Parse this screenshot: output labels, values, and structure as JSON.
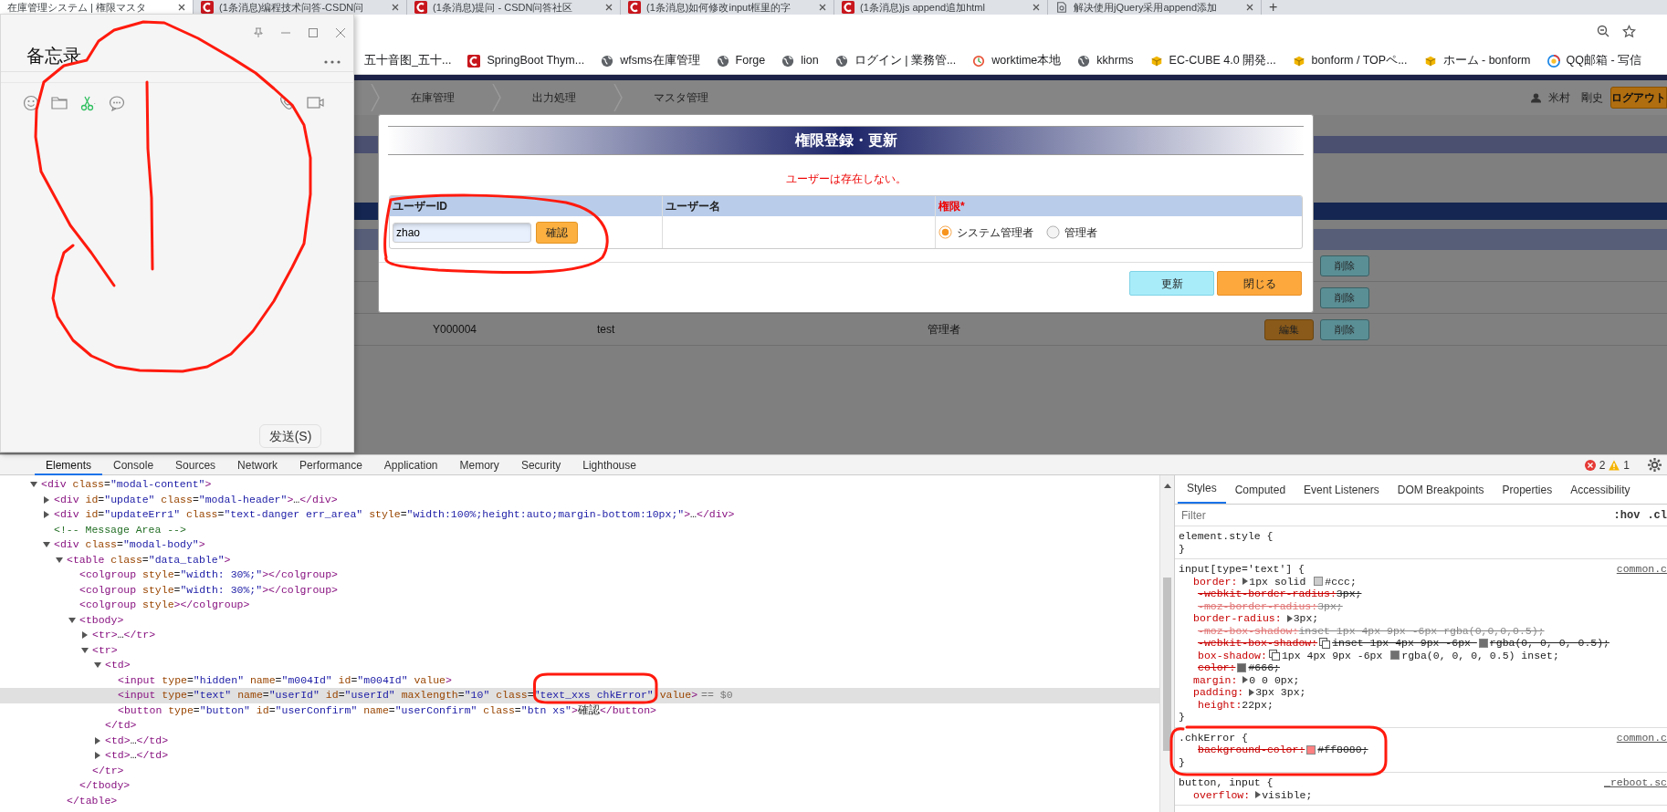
{
  "browser": {
    "tabs": [
      {
        "title": "在庫管理システム | 権限マスタ",
        "selected": true
      },
      {
        "title": "(1条消息)编程技术问答-CSDN问",
        "selected": false,
        "kind": "csdn"
      },
      {
        "title": "(1条消息)提问 - CSDN问答社区",
        "selected": false,
        "kind": "csdn"
      },
      {
        "title": "(1条消息)如何修改input框里的字",
        "selected": false,
        "kind": "csdn"
      },
      {
        "title": "(1条消息)js append追加html",
        "selected": false,
        "kind": "csdn"
      },
      {
        "title": "解决使用jQuery采用append添加",
        "selected": false,
        "kind": "page"
      }
    ],
    "new_tab": "+",
    "bookmarks": [
      {
        "label": "五十音图_五十..."
      },
      {
        "label": "SpringBoot Thym...",
        "kind": "csdn"
      },
      {
        "label": "wfsms在庫管理",
        "kind": "globe"
      },
      {
        "label": "Forge",
        "kind": "globe"
      },
      {
        "label": "lion",
        "kind": "globe"
      },
      {
        "label": "ログイン | 業務管...",
        "kind": "globe"
      },
      {
        "label": "worktime本地",
        "kind": "clock"
      },
      {
        "label": "kkhrms",
        "kind": "globe"
      },
      {
        "label": "EC-CUBE 4.0 開発...",
        "kind": "cube"
      },
      {
        "label": "bonform / TOPペ...",
        "kind": "cube"
      },
      {
        "label": "ホーム - bonform",
        "kind": "cube"
      },
      {
        "label": "QQ邮箱 - 写信",
        "kind": "mail"
      }
    ]
  },
  "app": {
    "nav": [
      "在庫管理",
      "出力処理",
      "マスタ管理"
    ],
    "user_name": "米村　剛史",
    "logout": "ログアウト",
    "rows": [
      {
        "buttons": [
          {
            "label": "削除",
            "kind": "delete"
          }
        ]
      },
      {
        "buttons": [
          {
            "label": "削除",
            "kind": "delete"
          }
        ]
      },
      {
        "id": "Y000004",
        "name": "test",
        "role": "管理者",
        "buttons": [
          {
            "label": "編集",
            "kind": "edit"
          },
          {
            "label": "削除",
            "kind": "delete"
          }
        ]
      }
    ]
  },
  "modal": {
    "title": "権限登録・更新",
    "error": "ユーザーは存在しない。",
    "columns": [
      {
        "label": "ユーザーID",
        "required": false
      },
      {
        "label": "ユーザー名",
        "required": false
      },
      {
        "label": "権限",
        "required": true,
        "mark": "*"
      }
    ],
    "user_id": "zhao",
    "confirm": "確認",
    "roles": [
      {
        "label": "システム管理者",
        "selected": true
      },
      {
        "label": "管理者",
        "selected": false
      }
    ],
    "buttons": [
      {
        "label": "更新",
        "kind": "update"
      },
      {
        "label": "閉じる",
        "kind": "close"
      }
    ]
  },
  "memo_window": {
    "title": "备忘录",
    "send": "发送(S)"
  },
  "devtools": {
    "tabs": [
      {
        "label": "Elements",
        "selected": true
      },
      {
        "label": "Console",
        "selected": false
      },
      {
        "label": "Sources",
        "selected": false
      },
      {
        "label": "Network",
        "selected": false
      },
      {
        "label": "Performance",
        "selected": false
      },
      {
        "label": "Application",
        "selected": false
      },
      {
        "label": "Memory",
        "selected": false
      },
      {
        "label": "Security",
        "selected": false
      },
      {
        "label": "Lighthouse",
        "selected": false
      }
    ],
    "errors": "2",
    "warnings": "1",
    "dom": [
      {
        "text": "<div class=\"modal-content\">",
        "expanded": true,
        "selected": false,
        "children": [
          {
            "text": "<div id=\"update\" class=\"modal-header\">…</div>",
            "expanded": false,
            "selected": false
          },
          {
            "text": "<div id=\"updateErr1\" class=\"text-danger err_area\" style=\"width:100%;height:auto;margin-bottom:10px;\">…</div>",
            "expanded": false,
            "selected": false
          },
          {
            "text": "<!-- Message Area  -->",
            "selected": false
          },
          {
            "text": "<div class=\"modal-body\">",
            "expanded": true,
            "selected": false,
            "children": [
              {
                "text": "<table class=\"data_table\">",
                "expanded": true,
                "selected": false,
                "close": "</table>",
                "children": [
                  {
                    "text": "<colgroup style=\"width: 30%;\"></colgroup>",
                    "selected": false
                  },
                  {
                    "text": "<colgroup style=\"width: 30%;\"></colgroup>",
                    "selected": false
                  },
                  {
                    "text": "<colgroup style></colgroup>",
                    "selected": false
                  },
                  {
                    "text": "<tbody>",
                    "expanded": true,
                    "selected": false,
                    "close": "</tbody>",
                    "children": [
                      {
                        "text": "<tr>…</tr>",
                        "expanded": false,
                        "selected": false
                      },
                      {
                        "text": "<tr>",
                        "expanded": true,
                        "selected": false,
                        "close": "</tr>",
                        "children": [
                          {
                            "text": "<td>",
                            "expanded": true,
                            "selected": false,
                            "close": "</td>",
                            "children": [
                              {
                                "text": "<input type=\"hidden\" name=\"m004Id\" id=\"m004Id\" value>",
                                "selected": false
                              },
                              {
                                "text": "<input type=\"text\" name=\"userId\" id=\"userId\" maxlength=\"10\" class=\"text_xxs chkError\" value>",
                                "selected": true,
                                "marker": "== $0"
                              },
                              {
                                "text": "<button type=\"button\" id=\"userConfirm\" name=\"userConfirm\" class=\"btn xs\">確認</button>",
                                "selected": false
                              }
                            ]
                          },
                          {
                            "text": "<td>…</td>",
                            "expanded": false,
                            "selected": false
                          },
                          {
                            "text": "<td>…</td>",
                            "expanded": false,
                            "selected": false
                          }
                        ]
                      }
                    ]
                  }
                ]
              }
            ]
          }
        ]
      }
    ],
    "styles": {
      "tabs": [
        {
          "label": "Styles",
          "selected": true
        },
        {
          "label": "Computed",
          "selected": false
        },
        {
          "label": "Event Listeners",
          "selected": false
        },
        {
          "label": "DOM Breakpoints",
          "selected": false
        },
        {
          "label": "Properties",
          "selected": false
        },
        {
          "label": "Accessibility",
          "selected": false
        }
      ],
      "filter_placeholder": "Filter",
      "hov": ":hov",
      "cls": ".cl",
      "rules": [
        {
          "selector": "element.style {",
          "close": "}"
        },
        {
          "selector": "input[type='text'] {",
          "source": "common.c",
          "close": "}",
          "props": [
            {
              "name": "border:",
              "expandable": true,
              "struck": false,
              "inactive": false,
              "parts": [
                {
                  "kind": "text",
                  "text": "1px solid "
                },
                {
                  "kind": "swatch",
                  "color": "#cccccc"
                },
                {
                  "kind": "text",
                  "text": "#ccc;"
                }
              ]
            },
            {
              "name": "-webkit-border-radius:",
              "expandable": false,
              "struck": true,
              "inactive": false,
              "parts": [
                {
                  "kind": "text",
                  "text": "3px;"
                }
              ]
            },
            {
              "name": "-moz-border-radius:",
              "expandable": false,
              "struck": true,
              "inactive": true,
              "parts": [
                {
                  "kind": "text",
                  "text": "3px;"
                }
              ]
            },
            {
              "name": "border-radius:",
              "expandable": true,
              "struck": false,
              "inactive": false,
              "parts": [
                {
                  "kind": "text",
                  "text": "3px;"
                }
              ]
            },
            {
              "name": "-moz-box-shadow:",
              "expandable": false,
              "struck": true,
              "inactive": true,
              "parts": [
                {
                  "kind": "text",
                  "text": "inset 1px 4px 9px -6px rgba(0,0,0,0.5);"
                }
              ]
            },
            {
              "name": "-webkit-box-shadow:",
              "expandable": false,
              "struck": true,
              "inactive": false,
              "parts": [
                {
                  "kind": "shadow"
                },
                {
                  "kind": "text",
                  "text": "inset 1px 4px 9px -6px "
                },
                {
                  "kind": "swatch",
                  "color": "#707070"
                },
                {
                  "kind": "text",
                  "text": "rgba(0, 0, 0, 0.5);"
                }
              ]
            },
            {
              "name": "box-shadow:",
              "expandable": false,
              "struck": false,
              "inactive": false,
              "parts": [
                {
                  "kind": "shadow"
                },
                {
                  "kind": "text",
                  "text": "1px 4px 9px -6px "
                },
                {
                  "kind": "swatch",
                  "color": "#707070"
                },
                {
                  "kind": "text",
                  "text": "rgba(0, 0, 0, 0.5) inset;"
                }
              ]
            },
            {
              "name": "color:",
              "expandable": false,
              "struck": true,
              "inactive": false,
              "parts": [
                {
                  "kind": "swatch",
                  "color": "#666666"
                },
                {
                  "kind": "text",
                  "text": "#666;"
                }
              ]
            },
            {
              "name": "margin:",
              "expandable": true,
              "struck": false,
              "inactive": false,
              "parts": [
                {
                  "kind": "text",
                  "text": "0 0 0px;"
                }
              ]
            },
            {
              "name": "padding:",
              "expandable": true,
              "struck": false,
              "inactive": false,
              "parts": [
                {
                  "kind": "text",
                  "text": "3px 3px;"
                }
              ]
            },
            {
              "name": "height:",
              "expandable": false,
              "struck": false,
              "inactive": false,
              "parts": [
                {
                  "kind": "text",
                  "text": "22px;"
                }
              ]
            }
          ]
        },
        {
          "selector": ".chkError {",
          "source": "common.c",
          "close": "}",
          "props": [
            {
              "name": "background-color:",
              "expandable": false,
              "struck": true,
              "inactive": false,
              "parts": [
                {
                  "kind": "swatch",
                  "color": "#ff8080"
                },
                {
                  "kind": "text",
                  "text": "#ff8080;"
                }
              ]
            }
          ]
        },
        {
          "selector": "button, input {",
          "source": "_reboot.sc",
          "props": [
            {
              "name": "overflow:",
              "expandable": true,
              "struck": false,
              "inactive": false,
              "parts": [
                {
                  "kind": "text",
                  "text": "visible;"
                }
              ]
            }
          ]
        }
      ]
    }
  }
}
